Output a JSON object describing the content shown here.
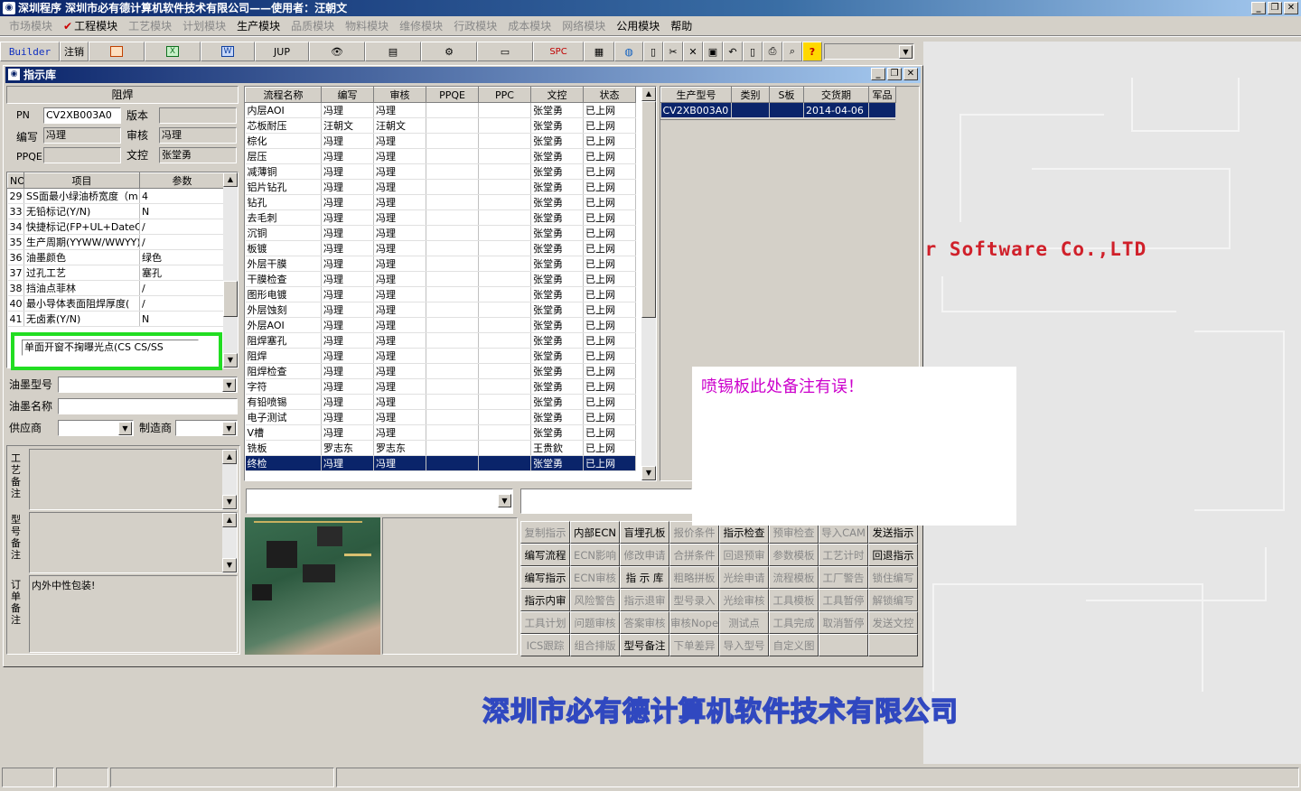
{
  "app": {
    "title": "深圳程序    深圳市必有德计算机软件技术有限公司——使用者：汪朝文",
    "window_controls": [
      "_",
      "❐",
      "✕"
    ]
  },
  "menu": [
    {
      "label": "市场模块",
      "enabled": false
    },
    {
      "label": "工程模块",
      "enabled": true,
      "checked": true
    },
    {
      "label": "工艺模块",
      "enabled": false
    },
    {
      "label": "计划模块",
      "enabled": false
    },
    {
      "label": "生产模块",
      "enabled": true
    },
    {
      "label": "品质模块",
      "enabled": false
    },
    {
      "label": "物料模块",
      "enabled": false
    },
    {
      "label": "维修模块",
      "enabled": false
    },
    {
      "label": "行政模块",
      "enabled": false
    },
    {
      "label": "成本模块",
      "enabled": false
    },
    {
      "label": "网络模块",
      "enabled": false
    },
    {
      "label": "公用模块",
      "enabled": true
    },
    {
      "label": "帮助",
      "enabled": true
    }
  ],
  "toolbar": {
    "builder": "Builder",
    "logout": "注销",
    "jup": "JUP",
    "spc": "SPC",
    "icons": [
      "powerpoint-icon",
      "excel-icon",
      "word-icon",
      "jup-icon",
      "eye-icon",
      "database-icon",
      "network-icon",
      "computer-icon",
      "spc-icon",
      "calculator-icon",
      "globe-icon",
      "new-doc-icon",
      "cut-icon",
      "delete-icon",
      "save-icon",
      "undo-icon",
      "preview-icon",
      "print-icon",
      "find-icon",
      "help-icon"
    ]
  },
  "child": {
    "title": "指示库",
    "section_title": "阻焊",
    "pn_label": "PN",
    "pn_value": "CV2XB003A0",
    "version_label": "版本",
    "version_value": "",
    "writer_label": "编写",
    "writer_value": "冯理",
    "reviewer_label": "审核",
    "reviewer_value": "冯理",
    "ppqe_label": "PPQE",
    "ppqe_value": "",
    "doc_label": "文控",
    "doc_value": "张堂勇",
    "param_headers": [
      "NO",
      "项目",
      "参数"
    ],
    "params": [
      [
        "29",
        "SS面最小绿油桥宽度（m",
        "4"
      ],
      [
        "33",
        "无铅标记(Y/N)",
        "N"
      ],
      [
        "34",
        "快捷标记(FP+UL+DateCo",
        "/"
      ],
      [
        "35",
        "生产周期(YYWW/WWYY)",
        "/"
      ],
      [
        "36",
        "油墨颜色",
        "绿色"
      ],
      [
        "37",
        "过孔工艺",
        "塞孔"
      ],
      [
        "38",
        "挡油点菲林",
        "/"
      ],
      [
        "40",
        "最小导体表面阻焊厚度(",
        "/"
      ],
      [
        "41",
        "无卤素(Y/N)",
        "N"
      ]
    ],
    "highlight_text": "单面开窗不掬曝光点(CS CS/SS",
    "ink_model_label": "油墨型号",
    "ink_name_label": "油墨名称",
    "supplier_label": "供应商",
    "maker_label": "制造商",
    "process_note_label": "工艺备注",
    "model_note_label": "型号备注",
    "order_note_label": "订单备注",
    "order_note_value": "内外中性包装!",
    "flow_headers": [
      "流程名称",
      "编写",
      "审核",
      "PPQE",
      "PPC",
      "文控",
      "状态"
    ],
    "flows": [
      [
        "内层AOI",
        "冯理",
        "冯理",
        "",
        "",
        "张堂勇",
        "已上网"
      ],
      [
        "芯板耐压",
        "汪朝文",
        "汪朝文",
        "",
        "",
        "张堂勇",
        "已上网"
      ],
      [
        "棕化",
        "冯理",
        "冯理",
        "",
        "",
        "张堂勇",
        "已上网"
      ],
      [
        "层压",
        "冯理",
        "冯理",
        "",
        "",
        "张堂勇",
        "已上网"
      ],
      [
        "减薄铜",
        "冯理",
        "冯理",
        "",
        "",
        "张堂勇",
        "已上网"
      ],
      [
        "铝片钻孔",
        "冯理",
        "冯理",
        "",
        "",
        "张堂勇",
        "已上网"
      ],
      [
        "钻孔",
        "冯理",
        "冯理",
        "",
        "",
        "张堂勇",
        "已上网"
      ],
      [
        "去毛刺",
        "冯理",
        "冯理",
        "",
        "",
        "张堂勇",
        "已上网"
      ],
      [
        "沉铜",
        "冯理",
        "冯理",
        "",
        "",
        "张堂勇",
        "已上网"
      ],
      [
        "板镀",
        "冯理",
        "冯理",
        "",
        "",
        "张堂勇",
        "已上网"
      ],
      [
        "外层干膜",
        "冯理",
        "冯理",
        "",
        "",
        "张堂勇",
        "已上网"
      ],
      [
        "干膜检查",
        "冯理",
        "冯理",
        "",
        "",
        "张堂勇",
        "已上网"
      ],
      [
        "图形电镀",
        "冯理",
        "冯理",
        "",
        "",
        "张堂勇",
        "已上网"
      ],
      [
        "外层蚀刻",
        "冯理",
        "冯理",
        "",
        "",
        "张堂勇",
        "已上网"
      ],
      [
        "外层AOI",
        "冯理",
        "冯理",
        "",
        "",
        "张堂勇",
        "已上网"
      ],
      [
        "阻焊塞孔",
        "冯理",
        "冯理",
        "",
        "",
        "张堂勇",
        "已上网"
      ],
      [
        "阻焊",
        "冯理",
        "冯理",
        "",
        "",
        "张堂勇",
        "已上网"
      ],
      [
        "阻焊检查",
        "冯理",
        "冯理",
        "",
        "",
        "张堂勇",
        "已上网"
      ],
      [
        "字符",
        "冯理",
        "冯理",
        "",
        "",
        "张堂勇",
        "已上网"
      ],
      [
        "有铅喷锡",
        "冯理",
        "冯理",
        "",
        "",
        "张堂勇",
        "已上网"
      ],
      [
        "电子测试",
        "冯理",
        "冯理",
        "",
        "",
        "张堂勇",
        "已上网"
      ],
      [
        "V槽",
        "冯理",
        "冯理",
        "",
        "",
        "张堂勇",
        "已上网"
      ],
      [
        "铣板",
        "罗志东",
        "罗志东",
        "",
        "",
        "王贵欽",
        "已上网"
      ],
      [
        "终检",
        "冯理",
        "冯理",
        "",
        "",
        "张堂勇",
        "已上网"
      ]
    ],
    "model_headers": [
      "生产型号",
      "类别",
      "S板",
      "交货期",
      "军品"
    ],
    "models": [
      [
        "CV2XB003A0",
        "",
        "",
        "2014-04-06",
        ""
      ]
    ],
    "buttons": [
      [
        "复制指示",
        "内部ECN",
        "盲埋孔板",
        "报价条件",
        "指示检查",
        "预审检查",
        "导入CAM",
        "发送指示"
      ],
      [
        "编写流程",
        "ECN影响",
        "修改申请",
        "合拼条件",
        "回退预审",
        "参数模板",
        "工艺计时",
        "回退指示"
      ],
      [
        "编写指示",
        "ECN审核",
        "指 示 库",
        "粗略拼板",
        "光绘申请",
        "流程模板",
        "工厂警告",
        "锁住编写"
      ],
      [
        "指示内审",
        "风险警告",
        "指示退审",
        "型号录入",
        "光绘审核",
        "工具模板",
        "工具暂停",
        "解锁编写"
      ],
      [
        "工具计划",
        "问题审核",
        "答案审核",
        "审核Nope",
        "测试点",
        "工具完成",
        "取消暂停",
        "发送文控"
      ],
      [
        "ICS跟踪",
        "组合排版",
        "型号备注",
        "下单差异",
        "导入型号",
        "自定义图",
        "",
        ""
      ]
    ],
    "buttons_enabled": [
      [
        false,
        true,
        true,
        false,
        true,
        false,
        false,
        true
      ],
      [
        true,
        false,
        false,
        false,
        false,
        false,
        false,
        true
      ],
      [
        true,
        false,
        true,
        false,
        false,
        false,
        false,
        false
      ],
      [
        true,
        false,
        false,
        false,
        false,
        false,
        false,
        false
      ],
      [
        false,
        false,
        false,
        false,
        false,
        false,
        false,
        false
      ],
      [
        false,
        false,
        true,
        false,
        false,
        false,
        false,
        false
      ]
    ]
  },
  "annotation": {
    "text": "喷锡板此处备注有误！",
    "color": "#cc00cc"
  },
  "desktop": {
    "software_text": "er Software Co.,LTD",
    "company_text": "深圳市必有德计算机软件技术有限公司",
    "accent_red": "#d0202a",
    "accent_blue": "#3048c0"
  },
  "colors": {
    "selection": "#0a246a",
    "highlight_border": "#22dd22"
  }
}
